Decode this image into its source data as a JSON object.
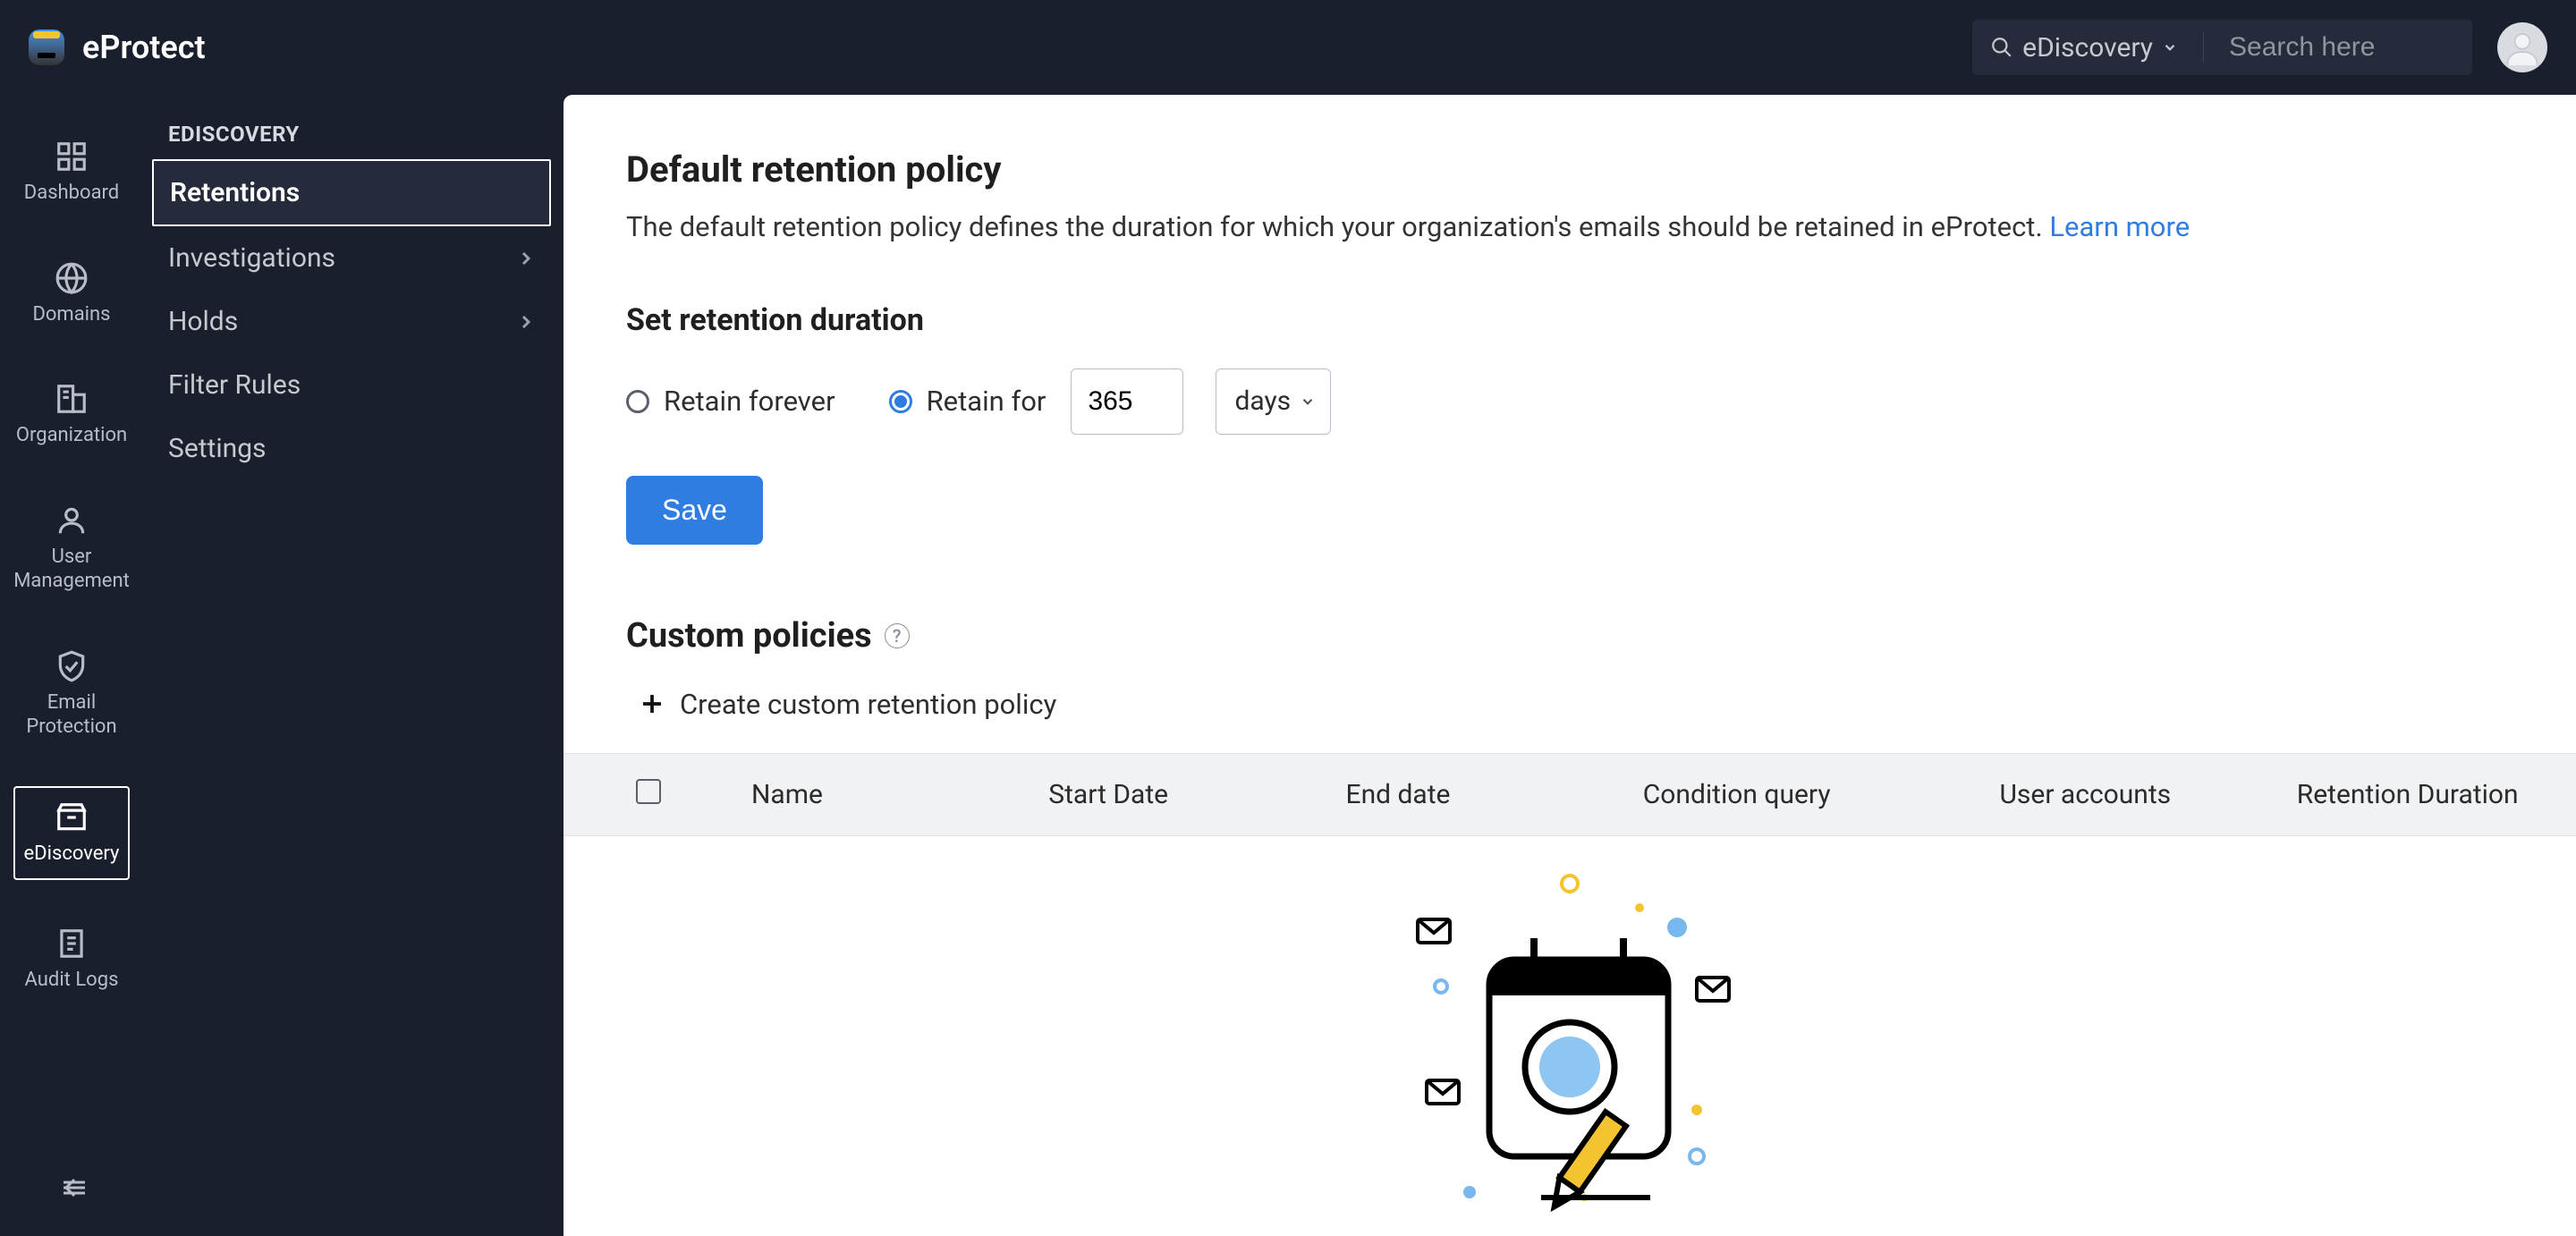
{
  "brand": {
    "name": "eProtect"
  },
  "topbar": {
    "search_scope": "eDiscovery",
    "search_placeholder": "Search here"
  },
  "iconbar": {
    "items": [
      {
        "key": "dashboard",
        "label": "Dashboard"
      },
      {
        "key": "domains",
        "label": "Domains"
      },
      {
        "key": "organization",
        "label": "Organization"
      },
      {
        "key": "user-management",
        "label": "User\nManagement"
      },
      {
        "key": "email-protection",
        "label": "Email\nProtection"
      },
      {
        "key": "ediscovery",
        "label": "eDiscovery",
        "active": true
      },
      {
        "key": "audit-logs",
        "label": "Audit Logs"
      }
    ]
  },
  "subnav": {
    "title": "EDISCOVERY",
    "items": [
      {
        "label": "Retentions",
        "active": true
      },
      {
        "label": "Investigations",
        "has_children": true
      },
      {
        "label": "Holds",
        "has_children": true
      },
      {
        "label": "Filter Rules"
      },
      {
        "label": "Settings"
      }
    ]
  },
  "main": {
    "title": "Default retention policy",
    "description": "The default retention policy defines the duration for which your organization's emails should be retained in eProtect. ",
    "learn_more": "Learn more",
    "set_duration_title": "Set retention duration",
    "retain_forever_label": "Retain forever",
    "retain_for_label": "Retain for",
    "retain_value": "365",
    "unit_label": "days",
    "save_label": "Save",
    "custom_policies_title": "Custom policies",
    "create_label": "Create custom retention policy",
    "table": {
      "cols": [
        "Name",
        "Start Date",
        "End date",
        "Condition query",
        "User accounts",
        "Retention Duration"
      ]
    }
  }
}
